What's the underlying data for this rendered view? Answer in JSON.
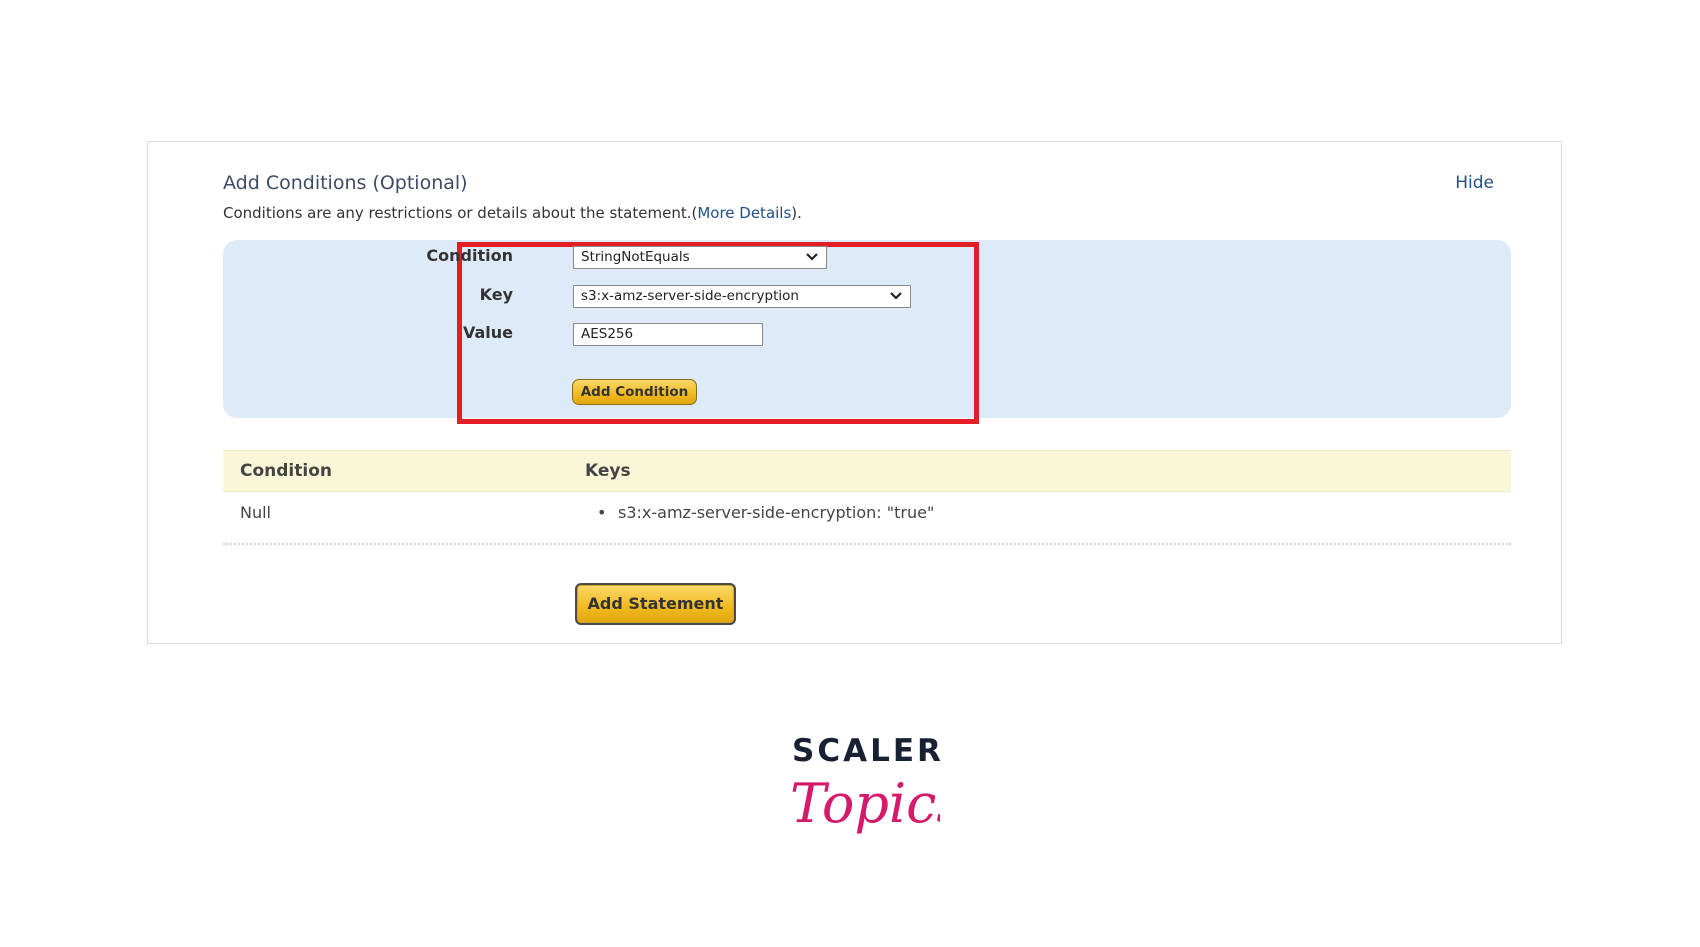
{
  "section": {
    "title": "Add Conditions (Optional)",
    "hide_link": "Hide",
    "description_text": "Conditions are any restrictions or details about the statement.(",
    "description_link": "More Details",
    "description_end": ")."
  },
  "form": {
    "condition_label": "Condition",
    "condition_value": "StringNotEquals",
    "key_label": "Key",
    "key_value": "s3:x-amz-server-side-encryption",
    "value_label": "Value",
    "value_value": "AES256",
    "add_condition_button": "Add Condition"
  },
  "table": {
    "headers": [
      "Condition",
      "Keys"
    ],
    "rows": [
      {
        "condition": "Null",
        "key_item": "s3:x-amz-server-side-encryption: \"true\""
      }
    ]
  },
  "add_statement_button": "Add Statement",
  "logo": {
    "line1": "SCALER",
    "line2": "Topics"
  },
  "colors": {
    "highlight": "#e21f26",
    "logo_pink": "#d6196b",
    "logo_navy": "#182034"
  }
}
